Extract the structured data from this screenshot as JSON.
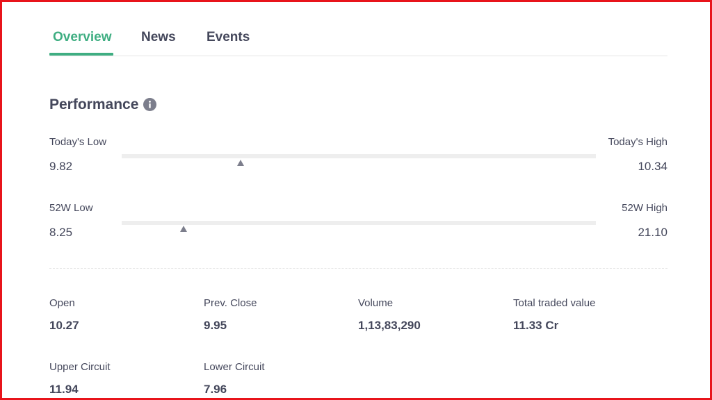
{
  "tabs": [
    {
      "label": "Overview",
      "active": true
    },
    {
      "label": "News",
      "active": false
    },
    {
      "label": "Events",
      "active": false
    }
  ],
  "performance": {
    "title": "Performance",
    "info_icon": "info-icon",
    "todays_range": {
      "low_label": "Today's Low",
      "low_value": "9.82",
      "high_label": "Today's High",
      "high_value": "10.34",
      "marker_fraction": 0.25
    },
    "week52_range": {
      "low_label": "52W Low",
      "low_value": "8.25",
      "high_label": "52W High",
      "high_value": "21.10",
      "marker_fraction": 0.13
    }
  },
  "stats": [
    {
      "label": "Open",
      "value": "10.27"
    },
    {
      "label": "Prev. Close",
      "value": "9.95"
    },
    {
      "label": "Volume",
      "value": "1,13,83,290"
    },
    {
      "label": "Total traded value",
      "value": "11.33 Cr"
    },
    {
      "label": "Upper Circuit",
      "value": "11.94"
    },
    {
      "label": "Lower Circuit",
      "value": "7.96"
    }
  ],
  "colors": {
    "accent": "#3fae82",
    "text": "#44475b",
    "frame": "#e8141b"
  }
}
